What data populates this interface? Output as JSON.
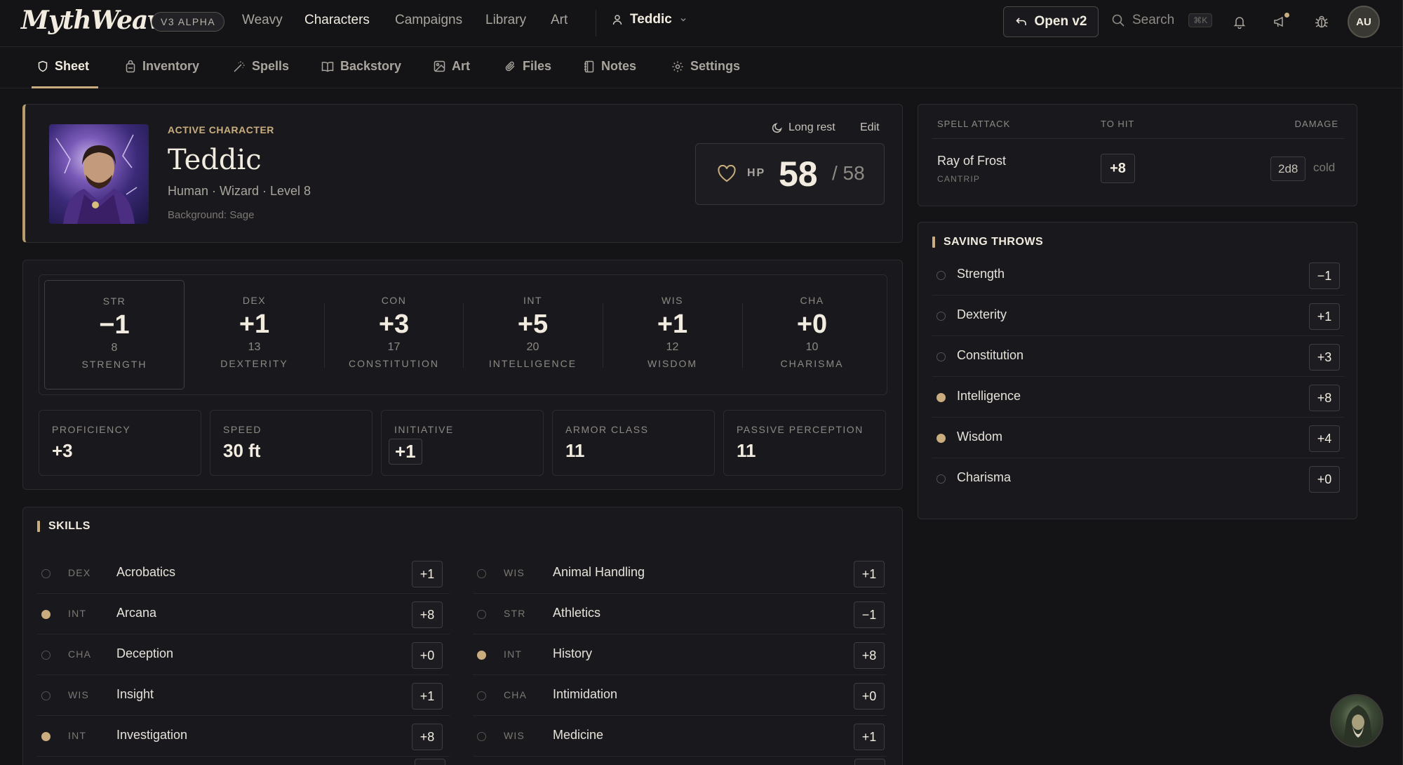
{
  "app": {
    "logo": "MythWeaver",
    "badge": "V3 ALPHA",
    "nav": [
      "Weavy",
      "Characters",
      "Campaigns",
      "Library",
      "Art"
    ],
    "active_nav": "Characters",
    "character_switch": "Teddic",
    "open_v2": "Open v2",
    "search_placeholder": "Search",
    "search_shortcut": "⌘K",
    "user_initials": "AU",
    "accent_color": "#c9ad7e"
  },
  "tabs": [
    "Sheet",
    "Inventory",
    "Spells",
    "Backstory",
    "Art",
    "Files",
    "Notes",
    "Settings"
  ],
  "hero": {
    "kicker": "ACTIVE CHARACTER",
    "name": "Teddic",
    "subtitle": "Human · Wizard · Level 8",
    "background": "Background: Sage",
    "long_rest": "Long rest",
    "edit": "Edit",
    "hp_label": "HP",
    "hp_current": "58",
    "hp_max": "/ 58"
  },
  "abilities": [
    {
      "abbr": "STR",
      "mod": "−1",
      "score": "8",
      "name": "STRENGTH"
    },
    {
      "abbr": "DEX",
      "mod": "+1",
      "score": "13",
      "name": "DEXTERITY"
    },
    {
      "abbr": "CON",
      "mod": "+3",
      "score": "17",
      "name": "CONSTITUTION"
    },
    {
      "abbr": "INT",
      "mod": "+5",
      "score": "20",
      "name": "INTELLIGENCE"
    },
    {
      "abbr": "WIS",
      "mod": "+1",
      "score": "12",
      "name": "WISDOM"
    },
    {
      "abbr": "CHA",
      "mod": "+0",
      "score": "10",
      "name": "CHARISMA"
    }
  ],
  "stats": [
    {
      "label": "PROFICIENCY",
      "value": "+3"
    },
    {
      "label": "SPEED",
      "value": "30 ft"
    },
    {
      "label": "INITIATIVE",
      "value": "+1"
    },
    {
      "label": "ARMOR CLASS",
      "value": "11"
    },
    {
      "label": "PASSIVE PERCEPTION",
      "value": "11"
    }
  ],
  "skills": {
    "title": "SKILLS",
    "left": [
      {
        "abbr": "DEX",
        "name": "Acrobatics",
        "mod": "+1",
        "proficient": false
      },
      {
        "abbr": "INT",
        "name": "Arcana",
        "mod": "+8",
        "proficient": true
      },
      {
        "abbr": "CHA",
        "name": "Deception",
        "mod": "+0",
        "proficient": false
      },
      {
        "abbr": "WIS",
        "name": "Insight",
        "mod": "+1",
        "proficient": false
      },
      {
        "abbr": "INT",
        "name": "Investigation",
        "mod": "+8",
        "proficient": true
      }
    ],
    "right": [
      {
        "abbr": "WIS",
        "name": "Animal Handling",
        "mod": "+1",
        "proficient": false
      },
      {
        "abbr": "STR",
        "name": "Athletics",
        "mod": "−1",
        "proficient": false
      },
      {
        "abbr": "INT",
        "name": "History",
        "mod": "+8",
        "proficient": true
      },
      {
        "abbr": "CHA",
        "name": "Intimidation",
        "mod": "+0",
        "proficient": false
      },
      {
        "abbr": "WIS",
        "name": "Medicine",
        "mod": "+1",
        "proficient": false
      }
    ]
  },
  "spell_attack": {
    "headers": {
      "spell": "SPELL ATTACK",
      "to_hit": "TO HIT",
      "damage": "DAMAGE"
    },
    "name": "Ray of Frost",
    "tag": "CANTRIP",
    "to_hit": "+8",
    "damage_dice": "2d8",
    "damage_type": "cold"
  },
  "saving_throws": {
    "title": "SAVING THROWS",
    "items": [
      {
        "name": "Strength",
        "mod": "−1",
        "proficient": false
      },
      {
        "name": "Dexterity",
        "mod": "+1",
        "proficient": false
      },
      {
        "name": "Constitution",
        "mod": "+3",
        "proficient": false
      },
      {
        "name": "Intelligence",
        "mod": "+8",
        "proficient": true
      },
      {
        "name": "Wisdom",
        "mod": "+4",
        "proficient": true
      },
      {
        "name": "Charisma",
        "mod": "+0",
        "proficient": false
      }
    ]
  }
}
